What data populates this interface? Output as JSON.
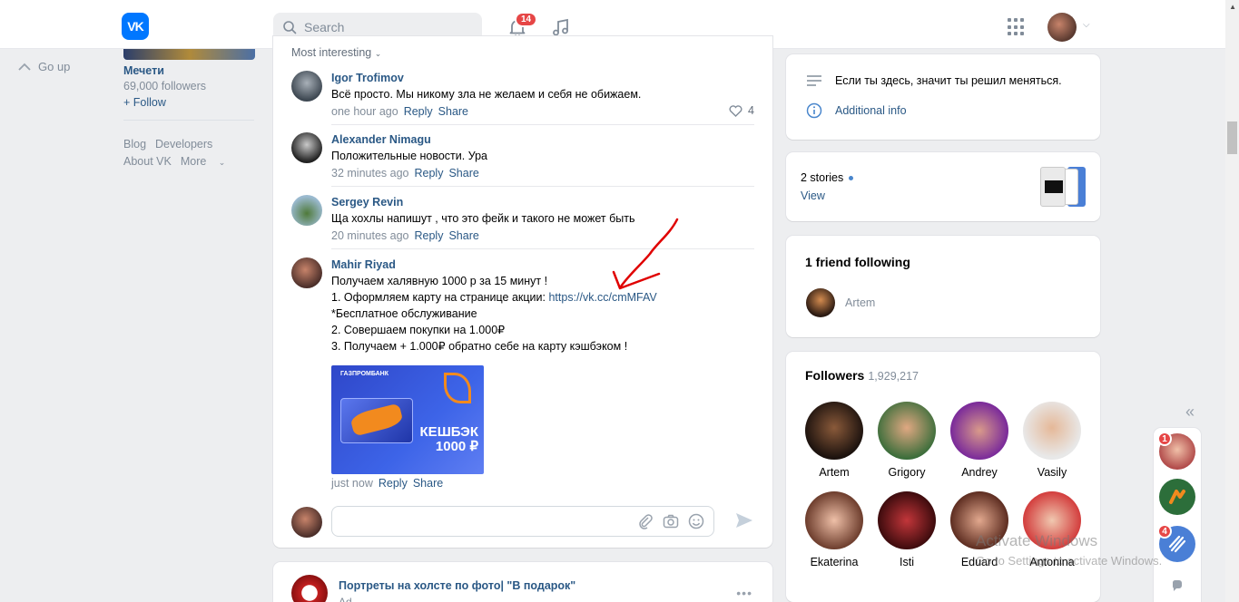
{
  "header": {
    "logo_text": "VK",
    "search_placeholder": "Search",
    "notifications_count": "14"
  },
  "left": {
    "go_up": "Go up",
    "group_name": "Мечети",
    "group_followers": "69,000 followers",
    "follow_label": "+ Follow",
    "links": [
      "Blog",
      "Developers",
      "About VK",
      "More"
    ]
  },
  "comments": {
    "sort_label": "Most interesting",
    "items": [
      {
        "name": "Igor Trofimov",
        "text": "Всё просто. Мы никому зла не желаем и себя не обижаем.",
        "time": "one hour ago",
        "reply": "Reply",
        "share": "Share",
        "likes": "4"
      },
      {
        "name": "Alexander Nimagu",
        "text": "Положительные новости. Ура",
        "time": "32 minutes ago",
        "reply": "Reply",
        "share": "Share"
      },
      {
        "name": "Sergey Revin",
        "text": "Ща хохлы напишут , что это фейк и такого не может быть",
        "time": "20 minutes ago",
        "reply": "Reply",
        "share": "Share"
      },
      {
        "name": "Mahir Riyad",
        "lines": [
          "Получаем халявную 1000 р за 15 минут !",
          "1. Оформляем карту на странице акции: ",
          "*Бесплатное обслуживание",
          "2. Совершаем покупки на 1.000₽",
          "3. Получаем + 1.000₽ обратно себе на карту кэшбэком !"
        ],
        "link": "https://vk.cc/cmMFAV",
        "time": "just now",
        "reply": "Reply",
        "share": "Share",
        "image": {
          "bank": "ГАЗПРОМБАНК",
          "cashback": "КЕШБЭК",
          "amount": "1000 ₽"
        }
      }
    ]
  },
  "ad": {
    "title": "Портреты на холсте по фото| \"В подарок\"",
    "label": "Ad"
  },
  "right": {
    "status": "Если ты здесь, значит ты решил меняться.",
    "additional_info": "Additional info",
    "stories_count": "2 stories",
    "stories_view": "View",
    "friend_following_title": "1 friend following",
    "friend_name": "Artem",
    "followers_title": "Followers",
    "followers_count": "1,929,217",
    "followers": [
      "Artem",
      "Grigory",
      "Andrey",
      "Vasily",
      "Ekaterina",
      "Isti",
      "Eduard",
      "Antonina"
    ]
  },
  "side": {
    "badge1": "1",
    "badge2": "4"
  },
  "watermark": {
    "line1": "Activate Windows",
    "line2": "Go to Settings to activate Windows."
  },
  "colors": {
    "accent": "#0077ff",
    "link": "#2a5885",
    "badge": "#e64646",
    "annotation_arrow": "#e00000"
  }
}
